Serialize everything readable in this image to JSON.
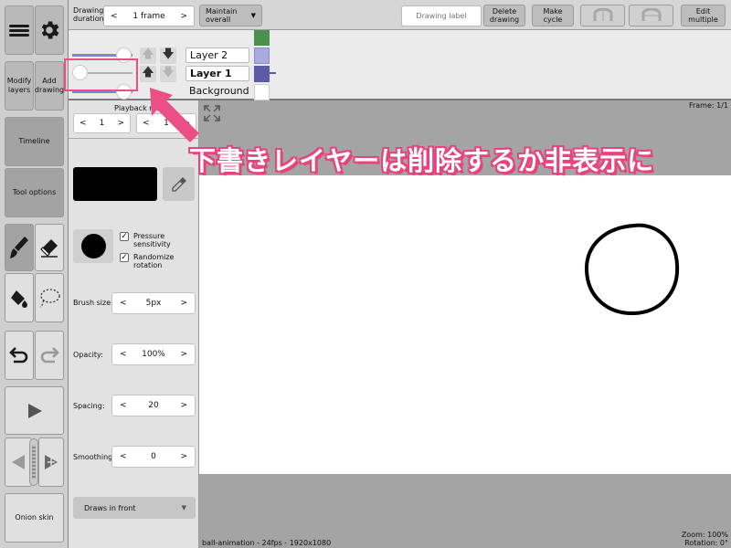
{
  "colors": {
    "accent": "#ec4f86",
    "layer_green": "#4d8f4d",
    "layer_lavender": "#aaaadd",
    "layer_indigo": "#5b5ba6"
  },
  "left_toolbar": {
    "menu_icon": "hamburger-menu-icon",
    "settings_icon": "gear-icon",
    "modify_layers_label": "Modify layers",
    "add_drawing_label": "Add drawing",
    "timeline_label": "Timeline",
    "tool_options_label": "Tool options",
    "onion_skin_label": "Onion skin"
  },
  "toolbar": {
    "drawing_duration_label": "Drawing duration:",
    "frame_stepper_value": "1 frame",
    "prev_symbol": "<",
    "next_symbol": ">",
    "maintain_label": "Maintain overall",
    "dropdown_symbol": "▼",
    "drawing_label_placeholder": "Drawing label",
    "delete_drawing_label": "Delete drawing",
    "make_cycle_label": "Make cycle",
    "edit_multiple_label": "Edit multiple"
  },
  "layers": {
    "items": [
      {
        "name": "Layer 2",
        "bold": false
      },
      {
        "name": "Layer 1",
        "bold": true
      },
      {
        "name": "Background",
        "bold": false
      }
    ],
    "up_symbol": "🡅",
    "down_symbol": "🡇"
  },
  "playback_range": {
    "label": "Playback range",
    "start": "1",
    "end": "1"
  },
  "tool_options": {
    "pressure_sensitivity_label": "Pressure sensitivity",
    "randomize_rotation_label": "Randomize rotation",
    "pressure_sensitivity_checked": true,
    "randomize_rotation_checked": true,
    "check_symbol": "✓",
    "brush_size_label": "Brush size:",
    "brush_size_value": "5px",
    "opacity_label": "Opacity:",
    "opacity_value": "100%",
    "spacing_label": "Spacing:",
    "spacing_value": "20",
    "smoothing_label": "Smoothing:",
    "smoothing_value": "0",
    "draws_in_front_label": "Draws in front"
  },
  "canvas": {
    "frame_indicator": "Frame: 1/1",
    "zoom": "Zoom: 100%",
    "rotation": "Rotation: 0°",
    "project_info": "ball-animation - 24fps - 1920x1080"
  },
  "annotation": {
    "callout_text": "下書きレイヤーは削除するか非表示に"
  }
}
